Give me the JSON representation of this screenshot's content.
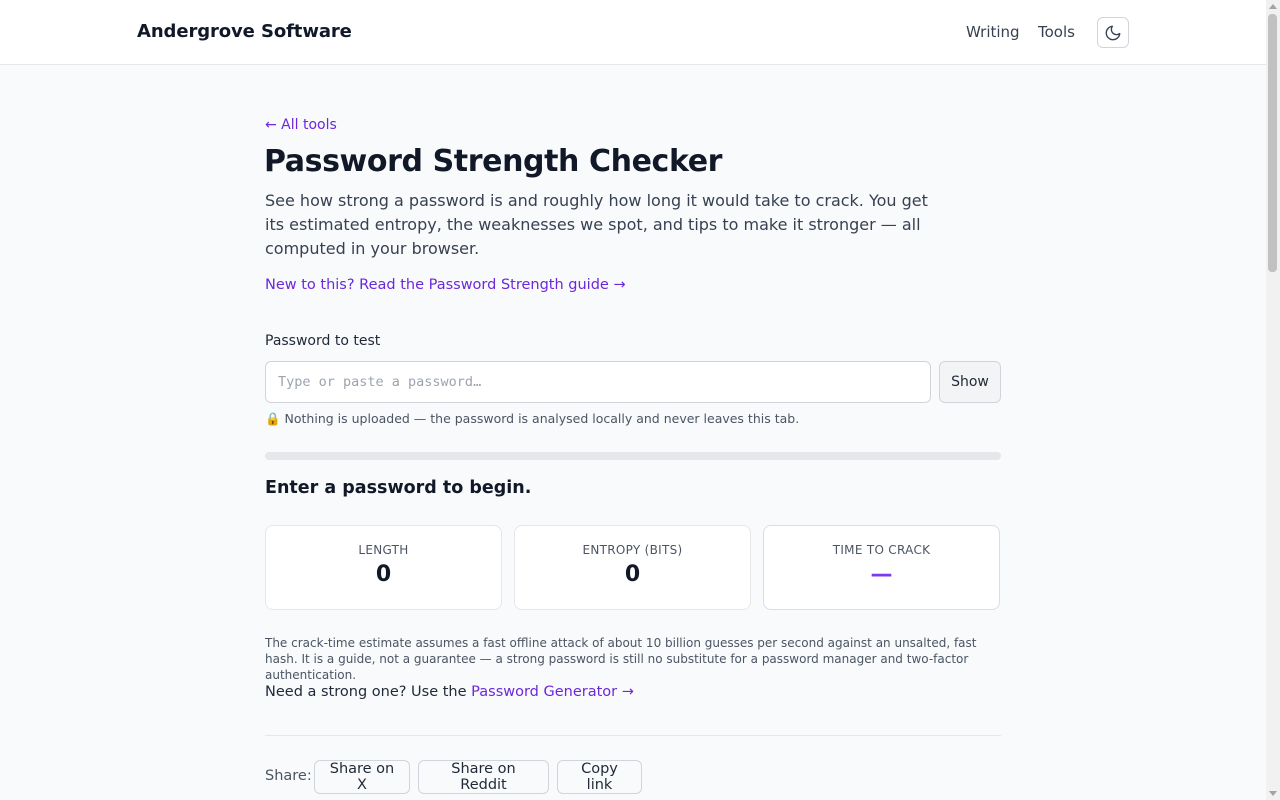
{
  "header": {
    "brand": "Andergrove Software",
    "nav": [
      "Writing",
      "Tools"
    ],
    "theme_icon": "moon-icon"
  },
  "main": {
    "back_link": "← All tools",
    "title": "Password Strength Checker",
    "intro": "See how strong a password is and roughly how long it would take to crack. You get its estimated entropy, the weaknesses we spot, and tips to make it stronger — all computed in your browser.",
    "guide_link": "New to this? Read the Password Strength guide →",
    "field_label": "Password to test",
    "input_value": "",
    "input_placeholder": "Type or paste a password…",
    "show_button": "Show",
    "privacy_note": "🔒 Nothing is uploaded — the password is analysed locally and never leaves this tab.",
    "strength_fraction": 0,
    "status_message": "Enter a password to begin.",
    "stats": [
      {
        "label": "LENGTH",
        "value": "0"
      },
      {
        "label": "ENTROPY (BITS)",
        "value": "0"
      },
      {
        "label": "TIME TO CRACK",
        "value": "—"
      }
    ],
    "disclaimer": "The crack-time estimate assumes a fast offline attack of about 10 billion guesses per second against an unsalted, fast hash. It is a guide, not a guarantee — a strong password is still no substitute for a password manager and two-factor authentication.",
    "generator_prefix": "Need a strong one? Use the ",
    "generator_link": "Password Generator →"
  },
  "share": {
    "label": "Share:",
    "buttons": [
      "Share on X",
      "Share on Reddit",
      "Copy link"
    ]
  },
  "colors": {
    "accent": "#7c3aed",
    "link": "#6d28d9",
    "background": "#f8fafc"
  }
}
